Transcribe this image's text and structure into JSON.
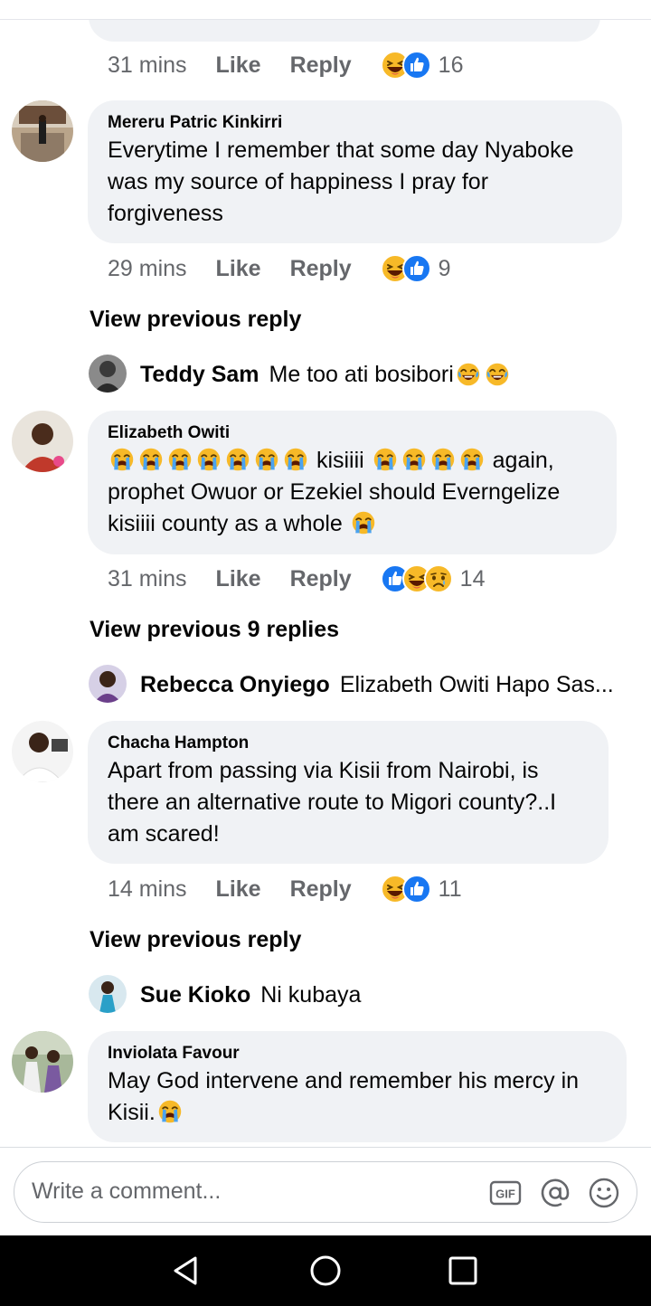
{
  "comments": [
    {
      "time": "31 mins",
      "like": "Like",
      "reply": "Reply",
      "reactions": [
        "haha",
        "like"
      ],
      "count": "16"
    },
    {
      "name": "Mereru Patric Kinkirri",
      "text_lines": [
        "Everytime I remember that some day Nyaboke",
        "was my source of happiness I pray for",
        "forgiveness"
      ],
      "time": "29 mins",
      "like": "Like",
      "reply": "Reply",
      "reactions": [
        "haha",
        "like"
      ],
      "count": "9",
      "view_previous": "View previous reply",
      "reply_preview": {
        "name": "Teddy Sam",
        "text": "Me too ati bosibori"
      }
    },
    {
      "name": "Elizabeth Owiti",
      "text_line1_word": "kisiiii",
      "text_line1_tail": "again,",
      "text_line2": "prophet Owuor or Ezekiel should Everngelize",
      "text_line3": "kisiiii county as a whole",
      "time": "31 mins",
      "like": "Like",
      "reply": "Reply",
      "reactions": [
        "like",
        "haha",
        "sad"
      ],
      "count": "14",
      "view_previous": "View previous 9 replies",
      "reply_preview": {
        "name": "Rebecca Onyiego",
        "text": "Elizabeth Owiti Hapo Sas..."
      }
    },
    {
      "name": "Chacha Hampton",
      "text_lines": [
        "Apart from passing via Kisii from Nairobi, is",
        "there an alternative route to Migori county?..I",
        "am scared!"
      ],
      "time": "14 mins",
      "like": "Like",
      "reply": "Reply",
      "reactions": [
        "haha",
        "like"
      ],
      "count": "11",
      "view_previous": "View previous reply",
      "reply_preview": {
        "name": "Sue Kioko",
        "text": "Ni kubaya"
      }
    },
    {
      "name": "Inviolata Favour",
      "text_line1": "May God intervene and remember his mercy in",
      "text_line2": "Kisii."
    }
  ],
  "composer": {
    "placeholder": "Write a comment...",
    "icons": [
      "gif-icon",
      "mention-icon",
      "emoji-icon"
    ]
  },
  "navbar": {
    "icons": [
      "back-icon",
      "home-icon",
      "recents-icon"
    ]
  },
  "colors": {
    "bubble": "#f0f2f5",
    "meta_text": "#65676b",
    "like_blue": "#1877f2",
    "emoji_yellow": "#f7b928"
  }
}
